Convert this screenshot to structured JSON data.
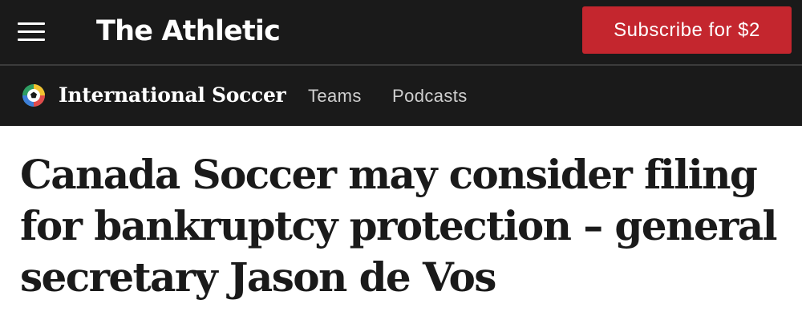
{
  "header": {
    "menu_icon": "hamburger-menu-icon",
    "brand": "The Athletic",
    "subscribe_label": "Subscribe for $2",
    "subscribe_color": "#c4262e",
    "background_color": "#1a1a1a"
  },
  "section_nav": {
    "logo_icon": "soccer-ball-icon",
    "title": "International Soccer",
    "links": [
      "Teams",
      "Podcasts"
    ]
  },
  "article": {
    "headline": "Canada Soccer may consider filing for bankruptcy protection – general secretary Jason de Vos"
  }
}
